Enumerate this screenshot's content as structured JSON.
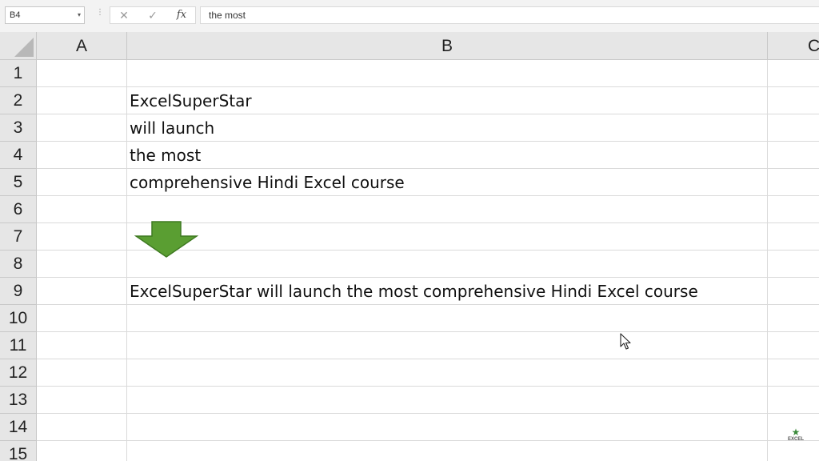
{
  "formula_bar": {
    "name_box": "B4",
    "name_box_arrow": "▾",
    "separator": "⋮",
    "cancel_icon": "✕",
    "enter_icon": "✓",
    "fx_label": "fx",
    "formula_value": "the most"
  },
  "columns": [
    "A",
    "B",
    "C"
  ],
  "rows": [
    "1",
    "2",
    "3",
    "4",
    "5",
    "6",
    "7",
    "8",
    "9",
    "10",
    "11",
    "12",
    "13",
    "14",
    "15"
  ],
  "cells": {
    "B2": "ExcelSuperStar",
    "B3": "will launch",
    "B4": "the most",
    "B5": "comprehensive Hindi Excel course",
    "B9": "ExcelSuperStar will launch the most comprehensive Hindi Excel course"
  },
  "decorations": {
    "arrow_icon": "down-arrow-icon",
    "arrow_color": "#5a9e32",
    "arrow_outline": "#3f7a22",
    "cursor_icon": "mouse-pointer-icon"
  },
  "watermark": {
    "star": "★",
    "text": "EXCEL"
  },
  "colors": {
    "header_bg": "#e6e6e6",
    "grid_line": "#dadada",
    "formula_bar_bg": "#f3f3f3"
  }
}
